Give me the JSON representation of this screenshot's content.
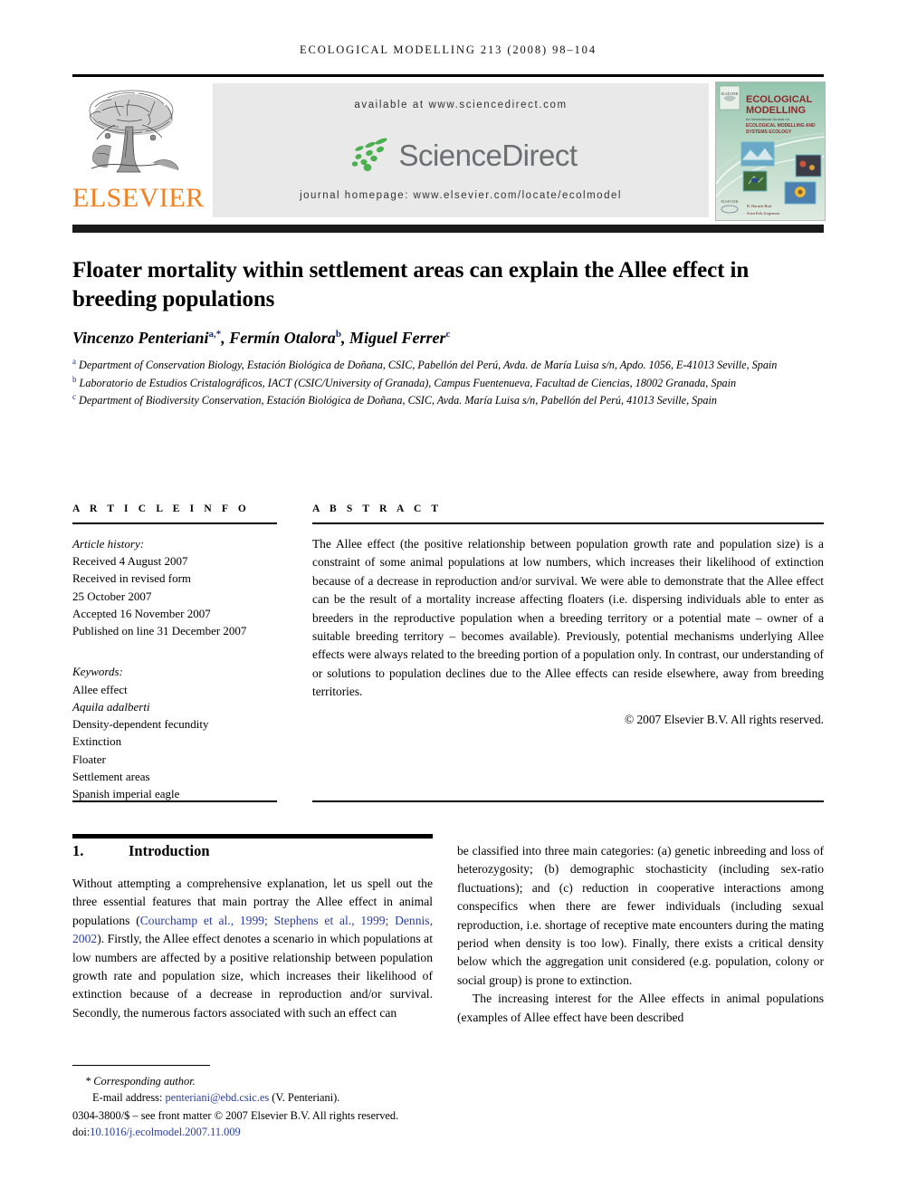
{
  "running_head": "ECOLOGICAL MODELLING 213 (2008) 98–104",
  "masthead": {
    "publisher_name": "ELSEVIER",
    "available_at": "available at www.sciencedirect.com",
    "sciencedirect_word": "ScienceDirect",
    "journal_homepage": "journal homepage: www.elsevier.com/locate/ecolmodel",
    "cover": {
      "title_line1": "ECOLOGICAL",
      "title_line2": "MODELLING",
      "subtitle1": "An International Journal on",
      "subtitle2": "ECOLOGICAL MODELLING AND",
      "subtitle3": "SYSTEMS ECOLOGY",
      "editor1": "B. Harnett Burl",
      "editor2": "Sven Erik Jorgensen"
    }
  },
  "article": {
    "title": "Floater mortality within settlement areas can explain the Allee effect in breeding populations",
    "authors": [
      {
        "name": "Vincenzo Penteriani",
        "marks": "a,*"
      },
      {
        "name": "Fermín Otalora",
        "marks": "b"
      },
      {
        "name": "Miguel Ferrer",
        "marks": "c"
      }
    ],
    "affiliations": [
      {
        "mark": "a",
        "text": "Department of Conservation Biology, Estación Biológica de Doñana, CSIC, Pabellón del Perú, Avda. de María Luisa s/n, Apdo. 1056, E-41013 Seville, Spain"
      },
      {
        "mark": "b",
        "text": "Laboratorio de Estudios Cristalográficos, IACT (CSIC/University of Granada), Campus Fuentenueva, Facultad de Ciencias, 18002 Granada, Spain"
      },
      {
        "mark": "c",
        "text": "Department of Biodiversity Conservation, Estación Biológica de Doñana, CSIC, Avda. María Luisa s/n, Pabellón del Perú, 41013 Seville, Spain"
      }
    ]
  },
  "article_info": {
    "label": "A R T I C L E  I N F O",
    "history_title": "Article history:",
    "history": [
      "Received 4 August 2007",
      "Received in revised form",
      "25 October 2007",
      "Accepted 16 November 2007",
      "Published on line 31 December 2007"
    ],
    "keywords_title": "Keywords:",
    "keywords": [
      "Allee effect",
      "Aquila adalberti",
      "Density-dependent fecundity",
      "Extinction",
      "Floater",
      "Settlement areas",
      "Spanish imperial eagle"
    ],
    "italic_keywords": [
      "Aquila adalberti"
    ]
  },
  "abstract": {
    "label": "A B S T R A C T",
    "text": "The Allee effect (the positive relationship between population growth rate and population size) is a constraint of some animal populations at low numbers, which increases their likelihood of extinction because of a decrease in reproduction and/or survival. We were able to demonstrate that the Allee effect can be the result of a mortality increase affecting floaters (i.e. dispersing individuals able to enter as breeders in the reproductive population when a breeding territory or a potential mate – owner of a suitable breeding territory – becomes available). Previously, potential mechanisms underlying Allee effects were always related to the breeding portion of a population only. In contrast, our understanding of or solutions to population declines due to the Allee effects can reside elsewhere, away from breeding territories.",
    "copyright": "© 2007 Elsevier B.V. All rights reserved."
  },
  "body": {
    "section_number": "1.",
    "section_title": "Introduction",
    "left_paragraph_pre": "Without attempting a comprehensive explanation, let us spell out the three essential features that main portray the Allee effect in animal populations (",
    "left_citation": "Courchamp et al., 1999; Stephens et al., 1999; Dennis, 2002",
    "left_paragraph_post": "). Firstly, the Allee effect denotes a scenario in which populations at low numbers are affected by a positive relationship between population growth rate and population size, which increases their likelihood of extinction because of a decrease in reproduction and/or survival. Secondly, the numerous factors associated with such an effect can",
    "right_paragraph_1": "be classified into three main categories: (a) genetic inbreeding and loss of heterozygosity; (b) demographic stochasticity (including sex-ratio fluctuations); and (c) reduction in cooperative interactions among conspecifics when there are fewer individuals (including sexual reproduction, i.e. shortage of receptive mate encounters during the mating period when density is too low). Finally, there exists a critical density below which the aggregation unit considered (e.g. population, colony or social group) is prone to extinction.",
    "right_paragraph_2": "The increasing interest for the Allee effects in animal populations (examples of Allee effect have been described"
  },
  "footnote": {
    "corresponding": "* Corresponding author.",
    "email_label": "E-mail address:",
    "email": "penteriani@ebd.csic.es",
    "email_suffix": "(V. Penteriani).",
    "issn_line": "0304-3800/$ – see front matter © 2007 Elsevier B.V. All rights reserved.",
    "doi_label": "doi:",
    "doi": "10.1016/j.ecolmodel.2007.11.009"
  },
  "colors": {
    "link_blue": "#2a3f9d",
    "elsevier_orange": "#f08020",
    "sciencedirect_green": "#43a047",
    "sciencedirect_gray": "#6c6f70",
    "band_gray": "#e9e9e9"
  }
}
